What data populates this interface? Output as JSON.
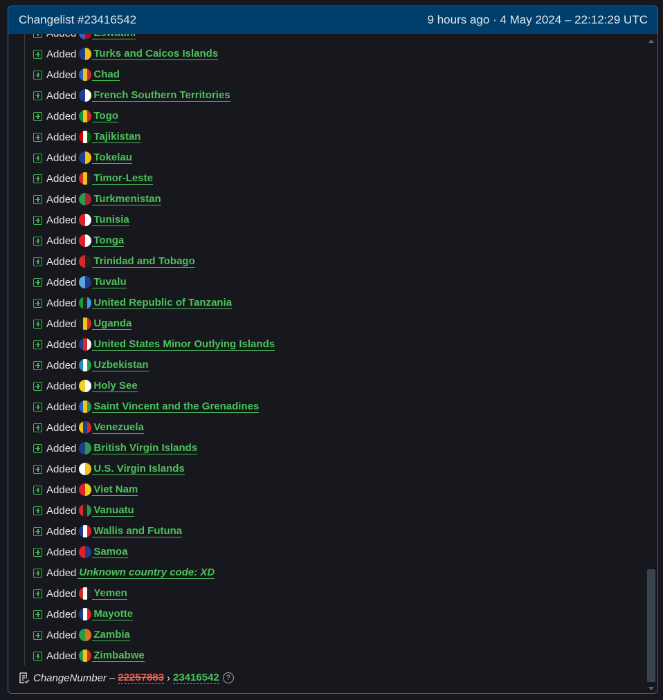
{
  "header": {
    "title": "Changelist #23416542",
    "timestamp": "9 hours ago · 4 May 2024 – 22:12:29 UTC"
  },
  "action_label": "Added",
  "items": [
    {
      "name": "Eswatini",
      "colors": [
        "#3e5eb9",
        "#b10c0c"
      ]
    },
    {
      "name": "Turks and Caicos Islands",
      "colors": [
        "#1f3d8c",
        "#f0c010"
      ]
    },
    {
      "name": "Chad",
      "colors": [
        "#2d5fbf",
        "#e8c020",
        "#d2283a"
      ]
    },
    {
      "name": "French Southern Territories",
      "colors": [
        "#1f3d8c",
        "#ffffff"
      ]
    },
    {
      "name": "Togo",
      "colors": [
        "#1a8a3a",
        "#f2c317",
        "#d62a2a"
      ]
    },
    {
      "name": "Tajikistan",
      "colors": [
        "#cc0000",
        "#ffffff",
        "#006600"
      ]
    },
    {
      "name": "Tokelau",
      "colors": [
        "#1f3d8c",
        "#f0c010"
      ]
    },
    {
      "name": "Timor-Leste",
      "colors": [
        "#d62a2a",
        "#f2c317",
        "#222222"
      ]
    },
    {
      "name": "Turkmenistan",
      "colors": [
        "#2a9a4a",
        "#b02030"
      ]
    },
    {
      "name": "Tunisia",
      "colors": [
        "#e0202a",
        "#ffffff"
      ]
    },
    {
      "name": "Tonga",
      "colors": [
        "#e0202a",
        "#ffffff"
      ]
    },
    {
      "name": "Trinidad and Tobago",
      "colors": [
        "#d62a2a",
        "#222222"
      ]
    },
    {
      "name": "Tuvalu",
      "colors": [
        "#5aa8e0",
        "#1f3d8c"
      ]
    },
    {
      "name": "United Republic of Tanzania",
      "colors": [
        "#1a9a3a",
        "#222222",
        "#3aa0e0"
      ]
    },
    {
      "name": "Uganda",
      "colors": [
        "#222222",
        "#f2c317",
        "#d62a2a"
      ]
    },
    {
      "name": "United States Minor Outlying Islands",
      "colors": [
        "#1f3d8c",
        "#d62a2a",
        "#ffffff"
      ]
    },
    {
      "name": "Uzbekistan",
      "colors": [
        "#2a8ac0",
        "#ffffff",
        "#2a9a4a"
      ]
    },
    {
      "name": "Holy See",
      "colors": [
        "#f2d020",
        "#ffffff"
      ]
    },
    {
      "name": "Saint Vincent and the Grenadines",
      "colors": [
        "#1f5fbf",
        "#f2c317",
        "#2a9a4a"
      ]
    },
    {
      "name": "Venezuela",
      "colors": [
        "#f2c317",
        "#1f3d8c",
        "#d62a2a"
      ]
    },
    {
      "name": "British Virgin Islands",
      "colors": [
        "#1f3d8c",
        "#2a9a4a"
      ]
    },
    {
      "name": "U.S. Virgin Islands",
      "colors": [
        "#ffffff",
        "#f2c317"
      ]
    },
    {
      "name": "Viet Nam",
      "colors": [
        "#e0202a",
        "#f2d020"
      ]
    },
    {
      "name": "Vanuatu",
      "colors": [
        "#d62a2a",
        "#222222",
        "#2a9a4a"
      ]
    },
    {
      "name": "Wallis and Futuna",
      "colors": [
        "#1f3d8c",
        "#ffffff",
        "#e0202a"
      ]
    },
    {
      "name": "Samoa",
      "colors": [
        "#e0202a",
        "#1f3d8c"
      ]
    },
    {
      "name": "Unknown country code: XD",
      "colors": [],
      "unknown": true
    },
    {
      "name": "Yemen",
      "colors": [
        "#d62a2a",
        "#ffffff",
        "#222222"
      ]
    },
    {
      "name": "Mayotte",
      "colors": [
        "#1f3d8c",
        "#ffffff",
        "#e0202a"
      ]
    },
    {
      "name": "Zambia",
      "colors": [
        "#2a9a4a",
        "#e07020"
      ]
    },
    {
      "name": "Zimbabwe",
      "colors": [
        "#2a9a4a",
        "#f2c317",
        "#d62a2a"
      ]
    }
  ],
  "footer": {
    "field": "ChangeNumber",
    "separator": "–",
    "old_value": "22257883",
    "arrow": "›",
    "new_value": "23416542",
    "help": "?"
  }
}
